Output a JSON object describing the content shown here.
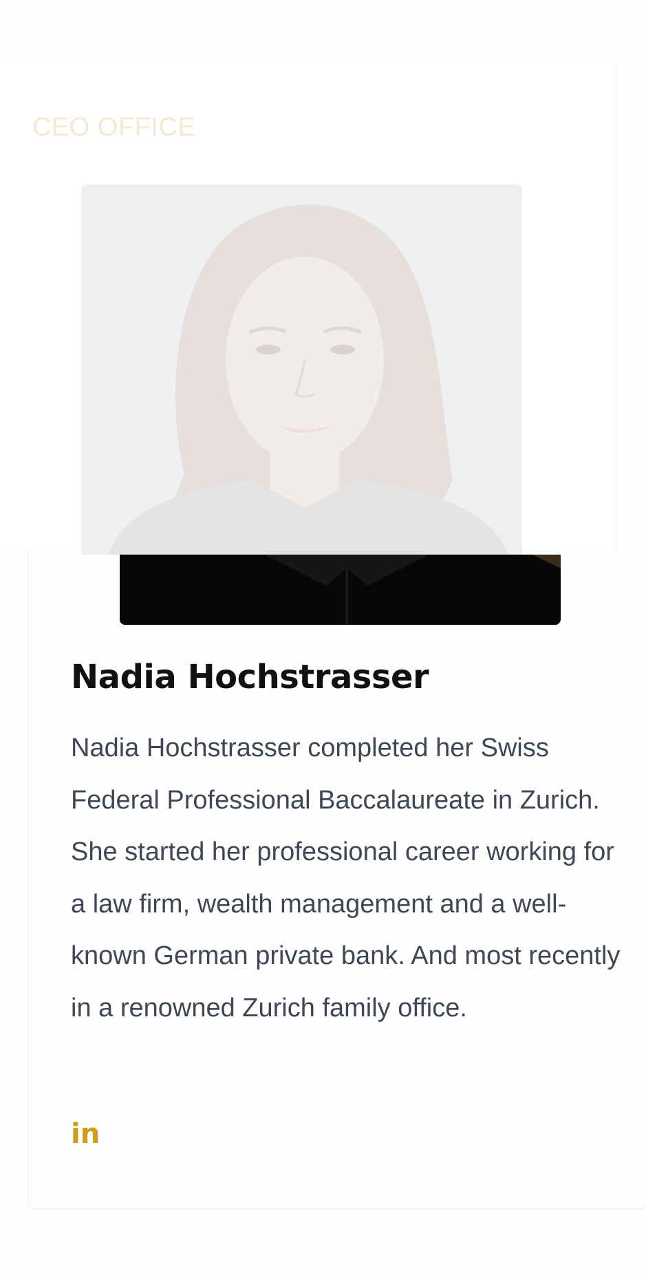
{
  "section": {
    "title": "CEO OFFICE"
  },
  "member": {
    "name": "Nadia Hochstrasser",
    "bio": "Nadia Hochstrasser completed her Swiss Federal Professional Baccalaureate in Zurich. She started her professional career working for a law firm, wealth management and a well-known German private bank. And most recently in a renowned Zurich family office.",
    "social": {
      "linkedin_label": "in"
    }
  },
  "colors": {
    "accent": "#d19b1c",
    "heading": "#111111",
    "body_text": "#3f4756",
    "section_title_faded": "#f5e9d2"
  },
  "icons": {
    "social": "linkedin-icon"
  }
}
